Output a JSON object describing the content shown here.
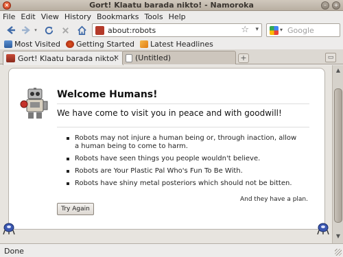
{
  "window": {
    "title": "Gort! Klaatu barada nikto! - Namoroka"
  },
  "menu": {
    "items": [
      "File",
      "Edit",
      "View",
      "History",
      "Bookmarks",
      "Tools",
      "Help"
    ]
  },
  "toolbar": {
    "url": "about:robots",
    "search_placeholder": "Google"
  },
  "bookmarks": {
    "items": [
      "Most Visited",
      "Getting Started",
      "Latest Headlines"
    ]
  },
  "tabs": [
    {
      "label": "Gort! Klaatu barada nikto!",
      "active": true
    },
    {
      "label": "(Untitled)",
      "active": false
    }
  ],
  "page": {
    "heading": "Welcome Humans!",
    "subheading": "We have come to visit you in peace and with goodwill!",
    "rules": [
      "Robots may not injure a human being or, through inaction, allow a human being to come to harm.",
      "Robots have seen things you people wouldn't believe.",
      "Robots are Your Plastic Pal Who's Fun To Be With.",
      "Robots have shiny metal posteriors which should not be bitten."
    ],
    "plan": "And they have a plan.",
    "button": "Try Again"
  },
  "status": {
    "text": "Done"
  }
}
